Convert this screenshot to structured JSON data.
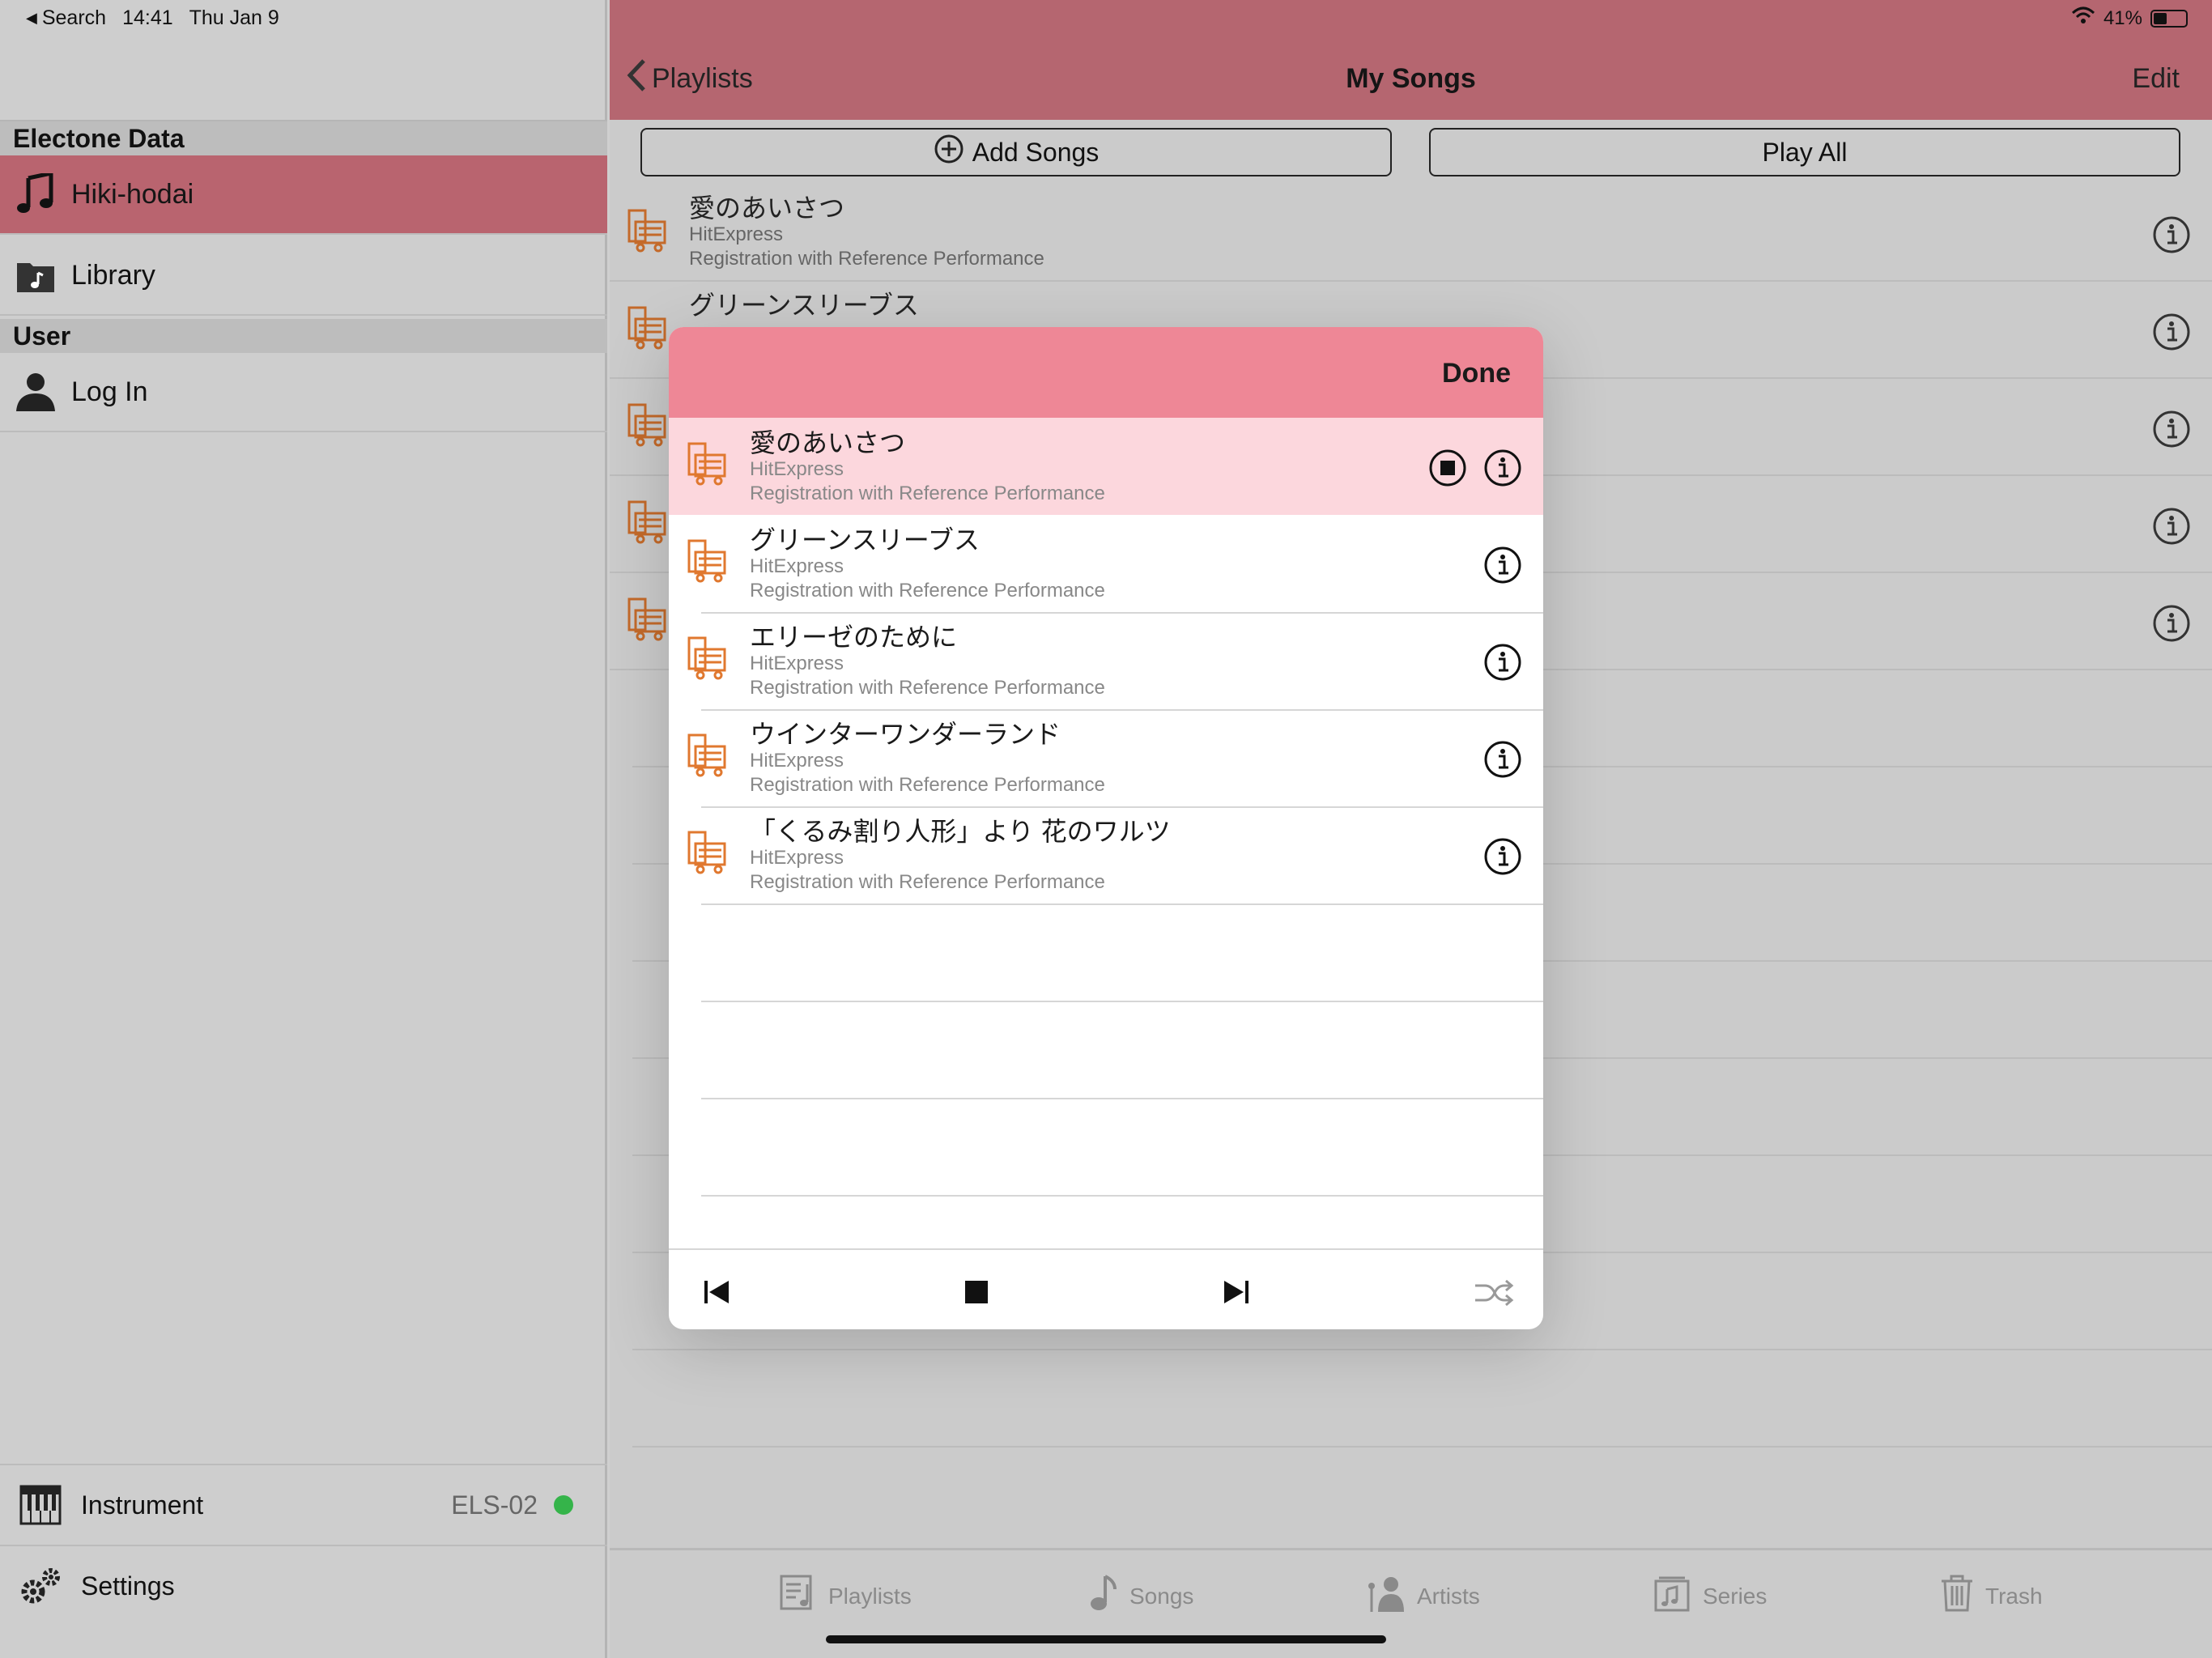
{
  "status_bar": {
    "back_app": "Search",
    "time": "14:41",
    "date": "Thu Jan 9",
    "battery": "41%"
  },
  "sidebar": {
    "section_electone": "Electone Data",
    "item_hiki": "Hiki-hodai",
    "item_library": "Library",
    "section_user": "User",
    "item_login": "Log In",
    "instrument_label": "Instrument",
    "instrument_value": "ELS-02",
    "settings_label": "Settings",
    "accent_color": "#b9646f",
    "connected_color": "#35b44a"
  },
  "nav": {
    "back_label": "Playlists",
    "title": "My Songs",
    "edit_label": "Edit",
    "color": "#b56670"
  },
  "actions": {
    "add_songs": "Add Songs",
    "play_all": "Play All"
  },
  "background_list": [
    {
      "title": "愛のあいさつ",
      "source": "HitExpress",
      "type": "Registration with Reference Performance"
    },
    {
      "title": "グリーンスリーブス"
    }
  ],
  "modal": {
    "done_label": "Done",
    "header_color": "#ee8796",
    "playing_row_color": "#fcd7dd",
    "songs": [
      {
        "title": "愛のあいさつ",
        "source": "HitExpress",
        "type": "Registration with Reference Performance"
      },
      {
        "title": "グリーンスリーブス",
        "source": "HitExpress",
        "type": "Registration with Reference Performance"
      },
      {
        "title": "エリーゼのために",
        "source": "HitExpress",
        "type": "Registration with Reference Performance"
      },
      {
        "title": "ウインターワンダーランド",
        "source": "HitExpress",
        "type": "Registration with Reference Performance"
      },
      {
        "title": "「くるみ割り人形」より 花のワルツ",
        "source": "HitExpress",
        "type": "Registration with Reference Performance"
      }
    ]
  },
  "tabs": {
    "playlists": "Playlists",
    "songs": "Songs",
    "artists": "Artists",
    "series": "Series",
    "trash": "Trash"
  }
}
